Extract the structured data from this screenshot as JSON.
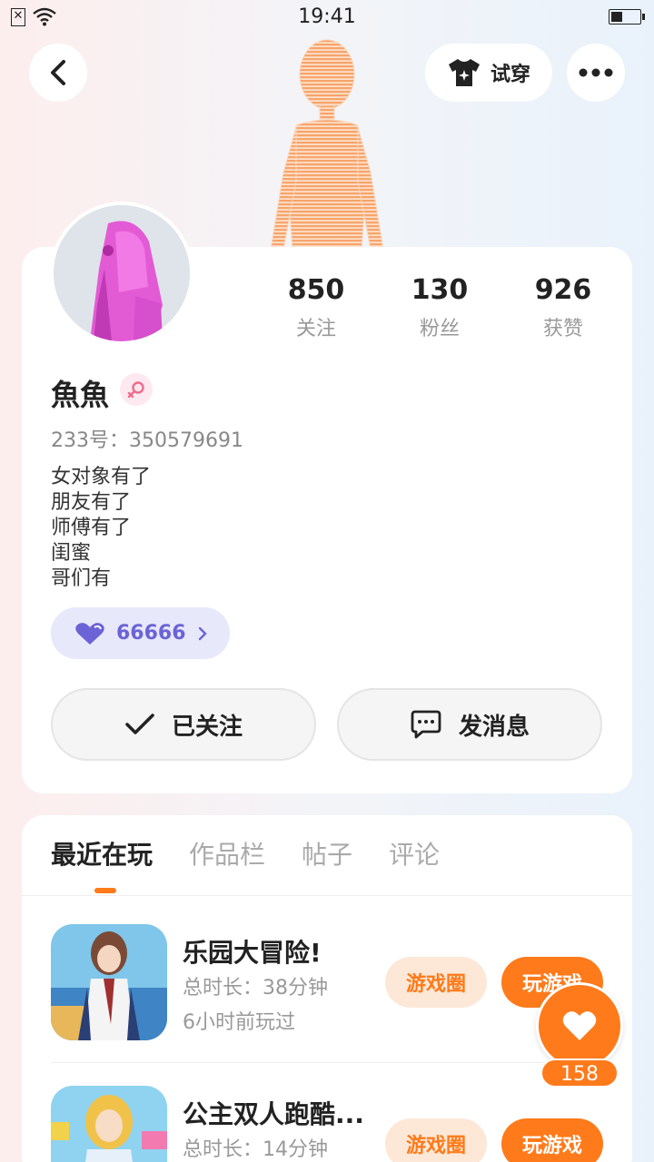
{
  "status_bar": {
    "time": "19:41"
  },
  "header": {
    "tryon_label": "试穿"
  },
  "profile": {
    "name": "魚魚",
    "uid": "233号：350579691",
    "bio": [
      "女对象有了",
      "朋友有了",
      "师傅有了",
      "闺蜜",
      "哥们有"
    ],
    "level_value": "66666",
    "stats": [
      {
        "value": "850",
        "label": "关注"
      },
      {
        "value": "130",
        "label": "粉丝"
      },
      {
        "value": "926",
        "label": "获赞"
      }
    ],
    "follow_label": "已关注",
    "message_label": "发消息"
  },
  "tabs": [
    {
      "label": "最近在玩",
      "active": true
    },
    {
      "label": "作品栏",
      "active": false
    },
    {
      "label": "帖子",
      "active": false
    },
    {
      "label": "评论",
      "active": false
    }
  ],
  "games": [
    {
      "title": "乐园大冒险!",
      "duration": "总时长：38分钟",
      "last_played": "6小时前玩过",
      "circle_label": "游戏圈",
      "play_label": "玩游戏"
    },
    {
      "title": "公主双人跑酷...",
      "duration": "总时长：14分钟",
      "last_played": "",
      "circle_label": "游戏圈",
      "play_label": "玩游戏"
    }
  ],
  "like_fab": {
    "count": "158"
  },
  "colors": {
    "accent": "#ff7a1a",
    "level": "#6b63d6",
    "gender": "#f06b8f"
  }
}
